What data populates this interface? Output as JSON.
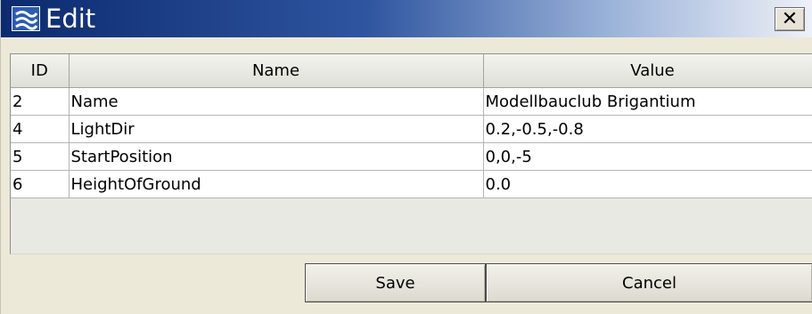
{
  "window": {
    "title": "Edit",
    "app_icon": "app-logo-icon",
    "close_glyph": "✕",
    "close_icon": "close-icon"
  },
  "table": {
    "columns": [
      "ID",
      "Name",
      "Value"
    ],
    "rows": [
      {
        "id": "2",
        "name": "Name",
        "value": "Modellbauclub Brigantium"
      },
      {
        "id": "4",
        "name": "LightDir",
        "value": "0.2,-0.5,-0.8"
      },
      {
        "id": "5",
        "name": "StartPosition",
        "value": "0,0,-5"
      },
      {
        "id": "6",
        "name": "HeightOfGround",
        "value": "0.0"
      }
    ]
  },
  "buttons": {
    "save_label": "Save",
    "cancel_label": "Cancel"
  },
  "colors": {
    "titlebar_start": "#0b2a6f",
    "titlebar_end": "#eef1f7",
    "dialog_background": "#ece9d8"
  }
}
